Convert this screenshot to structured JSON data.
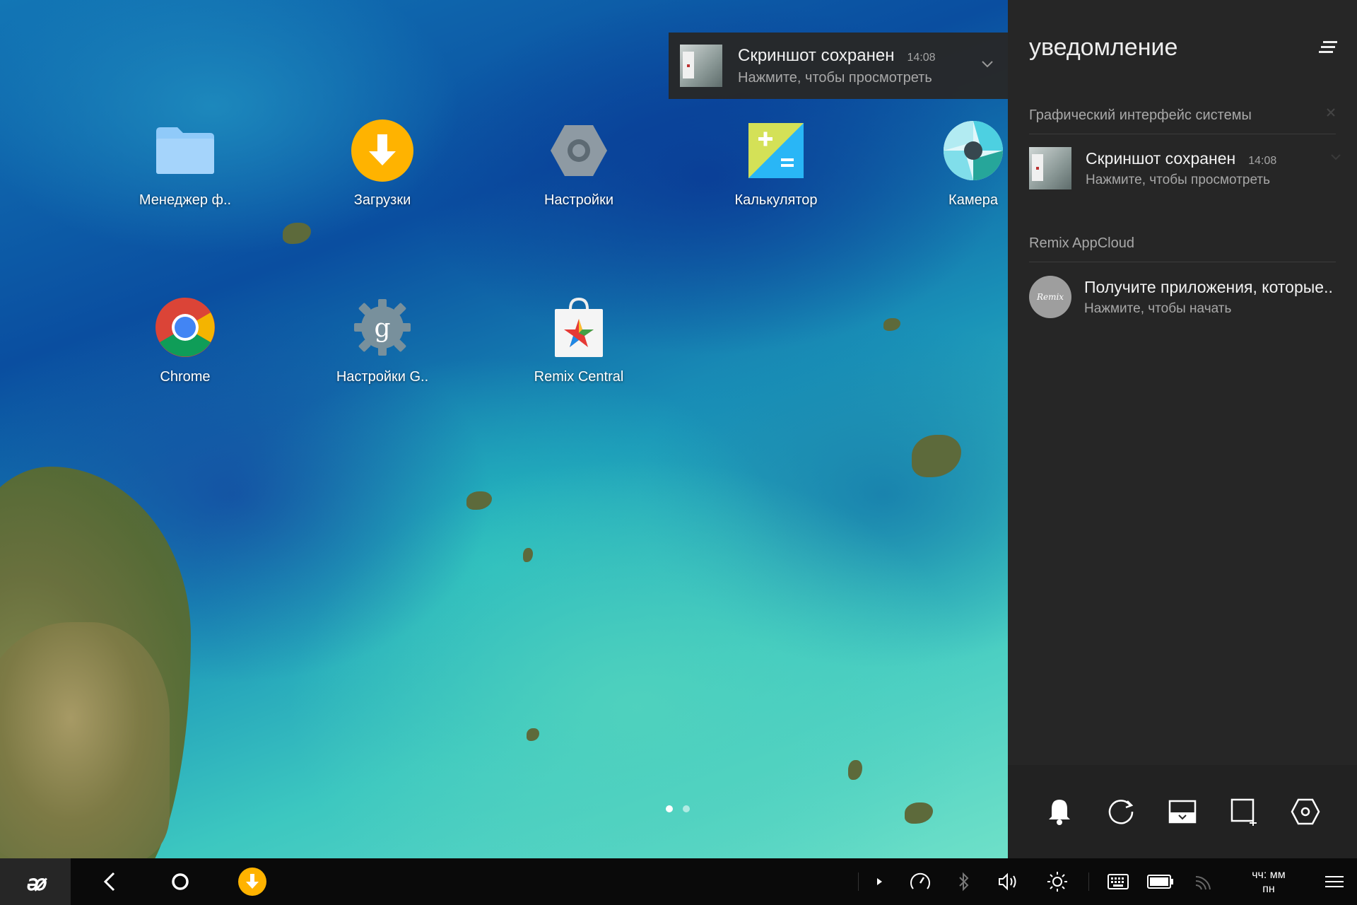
{
  "desktop": {
    "apps": [
      {
        "label": "Менеджер ф..",
        "icon": "folder-icon"
      },
      {
        "label": "Загрузки",
        "icon": "download-icon"
      },
      {
        "label": "Настройки",
        "icon": "settings-icon"
      },
      {
        "label": "Калькулятор",
        "icon": "calculator-icon"
      },
      {
        "label": "Камера",
        "icon": "camera-icon"
      },
      {
        "label": "Chrome",
        "icon": "chrome-icon"
      },
      {
        "label": "Настройки G..",
        "icon": "google-settings-icon"
      },
      {
        "label": "Remix Central",
        "icon": "remix-central-icon"
      }
    ],
    "page_dots": {
      "count": 2,
      "active": 0
    }
  },
  "heads_up": {
    "title": "Скриншот сохранен",
    "time": "14:08",
    "subtitle": "Нажмите, чтобы просмотреть"
  },
  "panel": {
    "title": "уведомление",
    "groups": [
      {
        "app": "Графический интерфейс системы",
        "notification": {
          "title": "Скриншот сохранен",
          "time": "14:08",
          "subtitle": "Нажмите, чтобы просмотреть"
        }
      },
      {
        "app": "Remix AppCloud",
        "notification": {
          "title": "Получите приложения, которые..",
          "subtitle": "Нажмите, чтобы начать",
          "avatar_text": "Remix"
        }
      }
    ],
    "controls": [
      "bell-icon",
      "rotate-icon",
      "keyboard-dock-icon",
      "screenshot-icon",
      "settings-icon"
    ]
  },
  "taskbar": {
    "clock_time": "чч: мм",
    "clock_day": "пн",
    "colors": {
      "accent": "#FFB300",
      "panel": "#262626"
    }
  }
}
